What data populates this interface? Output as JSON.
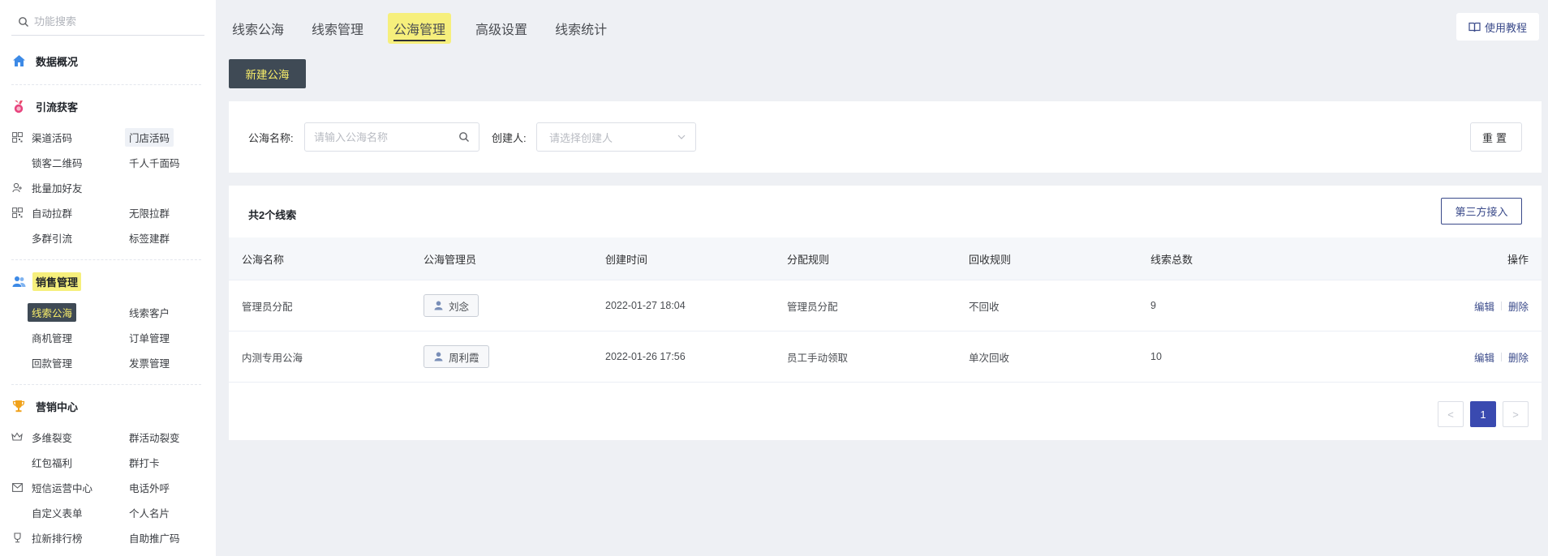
{
  "sidebar": {
    "search_placeholder": "功能搜索",
    "sections": {
      "overview": "数据概况",
      "traffic": "引流获客",
      "sales": "销售管理",
      "marketing": "营销中心"
    },
    "items": {
      "channel_code": "渠道活码",
      "store_code": "门店活码",
      "lock_qr": "锁客二维码",
      "thousand_faces": "千人千面码",
      "batch_friends": "批量加好友",
      "auto_group": "自动拉群",
      "unlimited_group": "无限拉群",
      "multi_group": "多群引流",
      "tag_group": "标签建群",
      "lead_pool": "线索公海",
      "lead_customer": "线索客户",
      "opportunity": "商机管理",
      "order": "订单管理",
      "payment": "回款管理",
      "invoice": "发票管理",
      "multi_fission": "多维裂变",
      "group_fission": "群活动裂变",
      "red_packet": "红包福利",
      "group_checkin": "群打卡",
      "sms_center": "短信运营中心",
      "phone_call": "电话外呼",
      "custom_form": "自定义表单",
      "business_card": "个人名片",
      "ranking": "拉新排行榜",
      "promo_code": "自助推广码"
    }
  },
  "tabs": [
    "线索公海",
    "线索管理",
    "公海管理",
    "高级设置",
    "线索统计"
  ],
  "active_tab": "公海管理",
  "help_label": "使用教程",
  "new_button": "新建公海",
  "filter": {
    "name_label": "公海名称:",
    "name_placeholder": "请输入公海名称",
    "creator_label": "创建人:",
    "creator_placeholder": "请选择创建人",
    "reset": "重置"
  },
  "table": {
    "total": "共2个线索",
    "third_party": "第三方接入",
    "columns": [
      "公海名称",
      "公海管理员",
      "创建时间",
      "分配规则",
      "回收规则",
      "线索总数",
      "操作"
    ],
    "rows": [
      {
        "name": "管理员分配",
        "admin": "刘念",
        "created": "2022-01-27 18:04",
        "assign": "管理员分配",
        "recycle": "不回收",
        "count": "9",
        "edit": "编辑",
        "delete": "删除"
      },
      {
        "name": "内测专用公海",
        "admin": "周利霞",
        "created": "2022-01-26 17:56",
        "assign": "员工手动领取",
        "recycle": "单次回收",
        "count": "10",
        "edit": "编辑",
        "delete": "删除"
      }
    ]
  },
  "pagination": {
    "prev": "<",
    "current": "1",
    "next": ">"
  },
  "colors": {
    "accent": "#3f4a55",
    "highlight": "#f6ef7c",
    "link": "#3a4a8a",
    "page_active": "#3a4ab0"
  }
}
